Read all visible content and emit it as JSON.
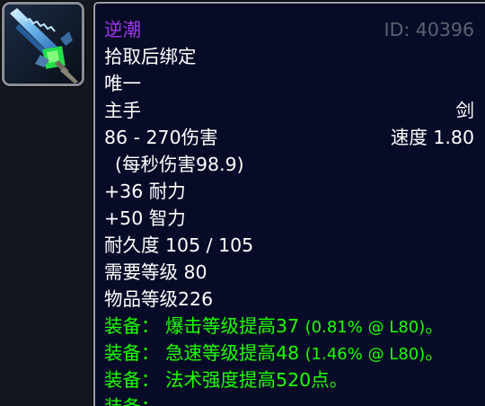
{
  "item": {
    "name": "逆潮",
    "id_label": "ID: 40396",
    "bind": "拾取后绑定",
    "unique": "唯一",
    "slot": "主手",
    "type": "剑",
    "damage": "86 - 270伤害",
    "speed": "速度 1.80",
    "dps": "(每秒伤害98.9)",
    "stamina": "+36 耐力",
    "intellect": "+50 智力",
    "durability": "耐久度 105 / 105",
    "required_level": "需要等级 80",
    "item_level": "物品等级226",
    "equip_effects": [
      {
        "label": "装备：",
        "text": "爆击等级提高37",
        "extra": "(0.81% @ L80)",
        "end": "。"
      },
      {
        "label": "装备：",
        "text": "急速等级提高48",
        "extra": "(1.46% @ L80)",
        "end": "。"
      },
      {
        "label": "装备：",
        "text": "法术强度提高520点。",
        "extra": "",
        "end": ""
      }
    ],
    "cut_off_line": "装备："
  },
  "colors": {
    "epic_name": "#a335ee",
    "id_gray": "#5d6170",
    "equip_green": "#1eff00",
    "tooltip_bg": "#070b27"
  },
  "icon": "sword-icon"
}
